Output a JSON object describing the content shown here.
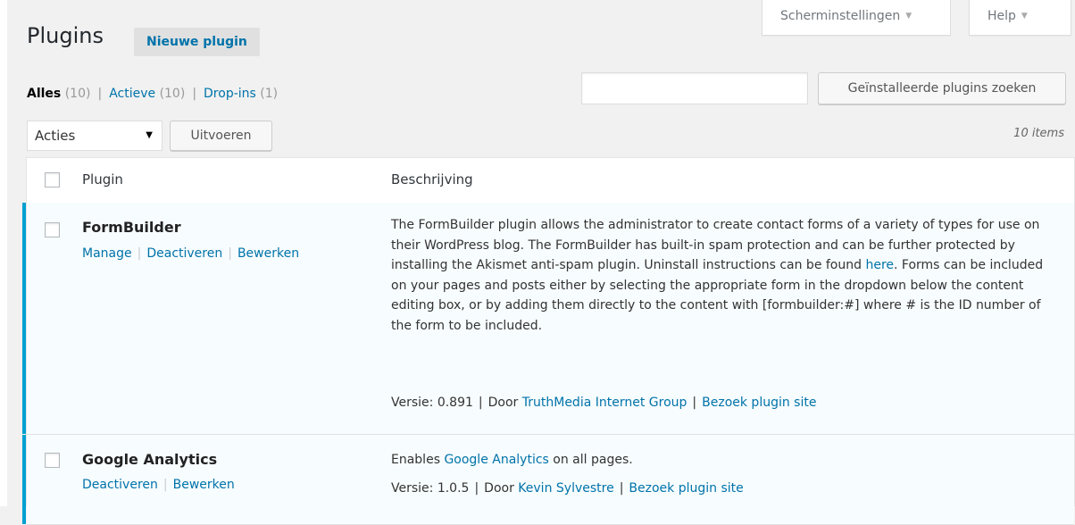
{
  "header": {
    "title": "Plugins",
    "new_plugin_label": "Nieuwe plugin",
    "screen_options_label": "Scherminstellingen",
    "help_label": "Help"
  },
  "filters": {
    "all": {
      "label": "Alles",
      "count": "(10)"
    },
    "active": {
      "label": "Actieve",
      "count": "(10)"
    },
    "dropins": {
      "label": "Drop-ins",
      "count": "(1)"
    }
  },
  "search": {
    "value": "",
    "button_label": "Geïnstalleerde plugins zoeken"
  },
  "bulk": {
    "selected": "Acties",
    "apply_label": "Uitvoeren"
  },
  "items_count": "10 items",
  "table": {
    "col_plugin": "Plugin",
    "col_description": "Beschrijving"
  },
  "plugins": [
    {
      "name": "FormBuilder",
      "actions": [
        "Manage",
        "Deactiveren",
        "Bewerken"
      ],
      "description_before": "The FormBuilder plugin allows the administrator to create contact forms of a variety of types for use on their WordPress blog. The FormBuilder has built-in spam protection and can be further protected by installing the Akismet anti-spam plugin. Uninstall instructions can be found ",
      "description_link": "here",
      "description_after": ". Forms can be included on your pages and posts either by selecting the appropriate form in the dropdown below the content editing box, or by adding them directly to the content with [formbuilder:#] where # is the ID number of the form to be included.",
      "version": "Versie: 0.891",
      "by_label": "Door",
      "author": "TruthMedia Internet Group",
      "site_link": "Bezoek plugin site"
    },
    {
      "name": "Google Analytics",
      "actions": [
        "Deactiveren",
        "Bewerken"
      ],
      "description_before": "Enables ",
      "description_link": "Google Analytics",
      "description_after": " on all pages.",
      "version": "Versie: 1.0.5",
      "by_label": "Door",
      "author": "Kevin Sylvestre",
      "site_link": "Bezoek plugin site"
    }
  ],
  "colors": {
    "link": "#0073aa",
    "active_bar": "#00a0d2",
    "active_row_bg": "#f7fcfe"
  }
}
